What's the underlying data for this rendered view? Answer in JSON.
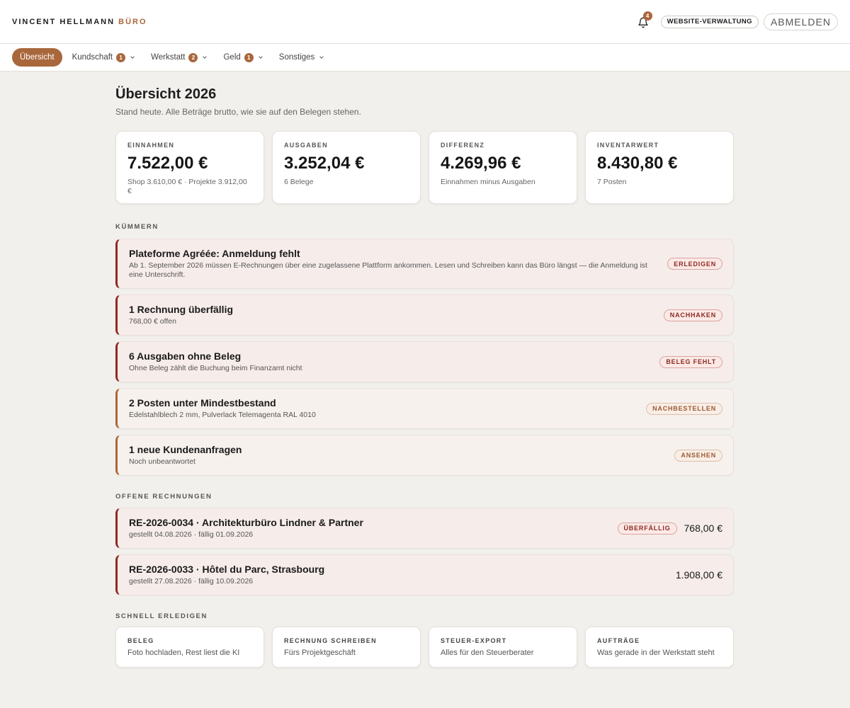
{
  "header": {
    "brand_main": "VINCENT HELLMANN",
    "brand_accent": "BÜRO",
    "notif_count": "4",
    "site_button": "WEBSITE-VERWALTUNG",
    "logout_button": "ABMELDEN",
    "accent_color": "#a9673c"
  },
  "nav": {
    "items": [
      {
        "label": "Übersicht"
      },
      {
        "label": "Kundschaft",
        "badge": "1"
      },
      {
        "label": "Werkstatt",
        "badge": "2"
      },
      {
        "label": "Geld",
        "badge": "1"
      },
      {
        "label": "Sonstiges"
      }
    ]
  },
  "page": {
    "title": "Übersicht 2026",
    "subtitle": "Stand heute. Alle Beträge brutto, wie sie auf den Belegen stehen."
  },
  "kpis": [
    {
      "label": "EINNAHMEN",
      "value": "7.522,00 €",
      "sub": "Shop 3.610,00 € · Projekte 3.912,00 €"
    },
    {
      "label": "AUSGABEN",
      "value": "3.252,04 €",
      "sub": "6 Belege"
    },
    {
      "label": "DIFFERENZ",
      "value": "4.269,96 €",
      "sub": "Einnahmen minus Ausgaben"
    },
    {
      "label": "INVENTARWERT",
      "value": "8.430,80 €",
      "sub": "7 Posten"
    }
  ],
  "kuemmern": {
    "title": "KÜMMERN",
    "items": [
      {
        "title": "Plateforme Agréée: Anmeldung fehlt",
        "desc": "Ab 1. September 2026 müssen E-Rechnungen über eine zugelassene Plattform ankommen. Lesen und Schreiben kann das Büro längst — die Anmeldung ist eine Unterschrift.",
        "tag": "ERLEDIGEN"
      },
      {
        "title": "1 Rechnung überfällig",
        "desc": "768,00 € offen",
        "tag": "NACHHAKEN"
      },
      {
        "title": "6 Ausgaben ohne Beleg",
        "desc": "Ohne Beleg zählt die Buchung beim Finanzamt nicht",
        "tag": "BELEG FEHLT"
      },
      {
        "title": "2 Posten unter Mindestbestand",
        "desc": "Edelstahlblech 2 mm, Pulverlack Telemagenta RAL 4010",
        "tag": "NACHBESTELLEN"
      },
      {
        "title": "1 neue Kundenanfragen",
        "desc": "Noch unbeantwortet",
        "tag": "ANSEHEN"
      }
    ]
  },
  "rechnungen": {
    "title": "OFFENE RECHNUNGEN",
    "items": [
      {
        "title": "RE-2026-0034 · Architekturbüro Lindner & Partner",
        "meta": "gestellt 04.08.2026 · fällig 01.09.2026",
        "tag": "ÜBERFÄLLIG",
        "amount": "768,00 €"
      },
      {
        "title": "RE-2026-0033 · Hôtel du Parc, Strasbourg",
        "meta": "gestellt 27.08.2026 · fällig 10.09.2026",
        "amount": "1.908,00 €"
      }
    ]
  },
  "schnell": {
    "title": "SCHNELL ERLEDIGEN",
    "items": [
      {
        "label": "BELEG",
        "sub": "Foto hochladen, Rest liest die KI"
      },
      {
        "label": "RECHNUNG SCHREIBEN",
        "sub": "Fürs Projektgeschäft"
      },
      {
        "label": "STEUER-EXPORT",
        "sub": "Alles für den Steuerberater"
      },
      {
        "label": "AUFTRÄGE",
        "sub": "Was gerade in der Werkstatt steht"
      }
    ]
  }
}
